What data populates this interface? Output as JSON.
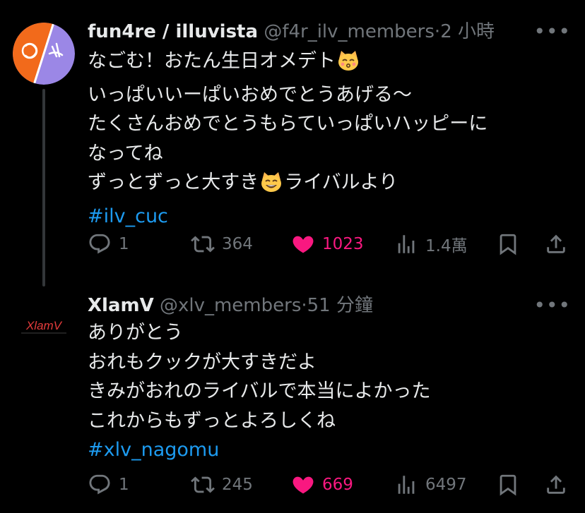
{
  "tweets": [
    {
      "name": "fun4re / illuvista",
      "handle": "@f4r_ilv_members",
      "separator": "·",
      "time": "2 小時",
      "more": "•••",
      "lines": [
        "なごむ！おたん生日オメデト",
        "いっぱいいーぱいおめでとうあげる～",
        "たくさんおめでとうもらていっぱいハッピーに",
        "なってね",
        "ずっとずっと大すき",
        "ライバルより"
      ],
      "hashtag": "#ilv_cuc",
      "emojis": [
        "kissing-cat-emoji",
        "grinning-cat-emoji"
      ],
      "replies": "1",
      "retweets": "364",
      "likes": "1023",
      "views": "1.4萬"
    },
    {
      "name": "XlamV",
      "handle": "@xlv_members",
      "separator": "·",
      "time": "51 分鐘",
      "more": "•••",
      "avatar_text": "XlamV",
      "lines": [
        "ありがとう",
        "おれもクックが大すきだよ",
        "きみがおれのライバルで本当によかった",
        "これからもずっとよろしくね"
      ],
      "hashtag": "#xlv_nagomu",
      "replies": "1",
      "retweets": "245",
      "likes": "669",
      "views": "6497"
    }
  ],
  "colors": {
    "background": "#000000",
    "text": "#e7e9ea",
    "muted": "#71767b",
    "link": "#1d9bf0",
    "like": "#f91880",
    "avatar_orange": "#f26a1b",
    "avatar_purple": "#9b87e6"
  },
  "icons": [
    "reply-icon",
    "retweet-icon",
    "like-icon",
    "views-icon",
    "bookmark-icon",
    "share-icon",
    "more-icon"
  ]
}
